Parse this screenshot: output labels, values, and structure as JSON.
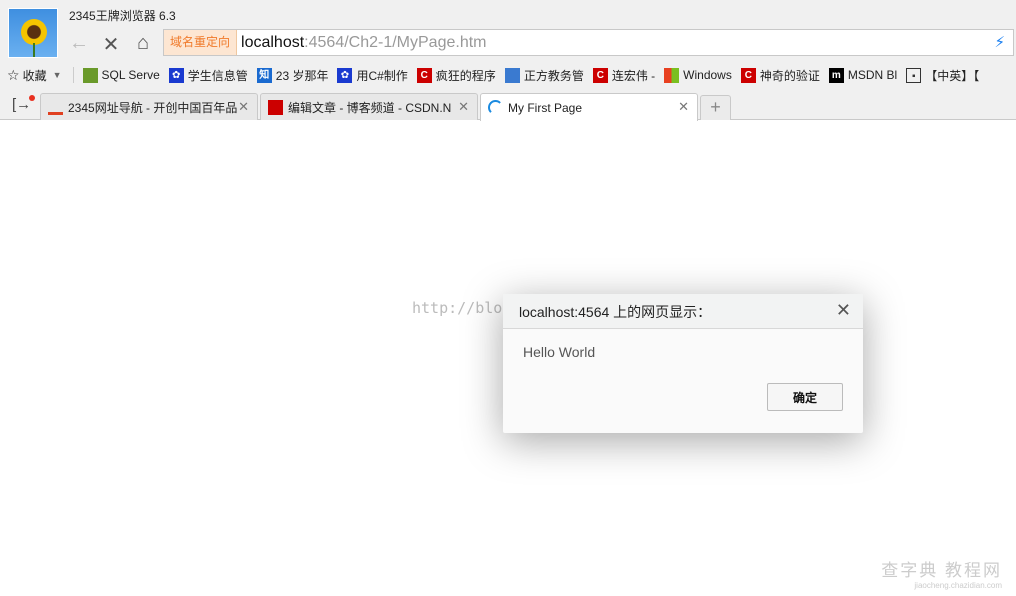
{
  "browser": {
    "title": "2345王牌浏览器 6.3",
    "redirect_badge": "域名重定向",
    "url_host": "localhost",
    "url_rest": ":4564/Ch2-1/MyPage.htm"
  },
  "bookmarks": {
    "favorites": "收藏",
    "items": [
      {
        "label": "SQL Serve",
        "color": "#6a9a2a"
      },
      {
        "label": "学生信息管",
        "color": "#1a3ad0"
      },
      {
        "label": "23 岁那年",
        "color": "#1a6ad0"
      },
      {
        "label": "用C#制作",
        "color": "#1a3ad0"
      },
      {
        "label": "疯狂的程序",
        "color": "#cc0000"
      },
      {
        "label": "正方教务管",
        "color": "#3a7ad0"
      },
      {
        "label": "连宏伟 -",
        "color": "#cc0000"
      },
      {
        "label": "Windows",
        "color": "#1a8ae0"
      },
      {
        "label": "神奇的验证",
        "color": "#cc0000"
      },
      {
        "label": "MSDN Bl",
        "color": "#000000"
      },
      {
        "label": "【中英】【",
        "color": "#333333"
      }
    ]
  },
  "tabs": [
    {
      "label": "2345网址导航 - 开创中国百年品"
    },
    {
      "label": "编辑文章 - 博客频道 - CSDN.N"
    },
    {
      "label": "My First Page"
    }
  ],
  "watermark": "http://blog.csdn.net/",
  "dialog": {
    "title": "localhost:4564 上的网页显示：",
    "message": "Hello World",
    "ok": "确定"
  },
  "site_watermark": {
    "main": "查字典 教程网",
    "sub": "jiaocheng.chazidian.com"
  }
}
